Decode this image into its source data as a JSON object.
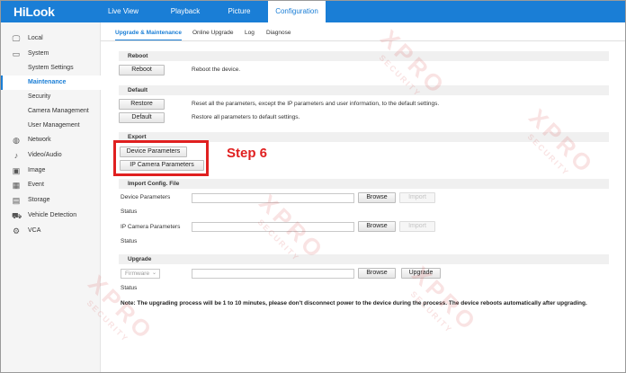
{
  "app": {
    "logo": "HiLook"
  },
  "nav": {
    "tabs": [
      {
        "label": "Live View"
      },
      {
        "label": "Playback"
      },
      {
        "label": "Picture"
      },
      {
        "label": "Configuration"
      }
    ]
  },
  "sidebar": {
    "local": "Local",
    "system": "System",
    "system_settings": "System Settings",
    "maintenance": "Maintenance",
    "security": "Security",
    "camera_management": "Camera Management",
    "user_management": "User Management",
    "network": "Network",
    "video_audio": "Video/Audio",
    "image": "Image",
    "event": "Event",
    "storage": "Storage",
    "vehicle_detection": "Vehicle Detection",
    "vca": "VCA"
  },
  "subtabs": {
    "upgrade_maintenance": "Upgrade & Maintenance",
    "online_upgrade": "Online Upgrade",
    "log": "Log",
    "diagnose": "Diagnose"
  },
  "reboot": {
    "title": "Reboot",
    "button": "Reboot",
    "desc": "Reboot the device."
  },
  "default": {
    "title": "Default",
    "restore_button": "Restore",
    "restore_desc": "Reset all the parameters, except the IP parameters and user information, to the default settings.",
    "default_button": "Default",
    "default_desc": "Restore all parameters to default settings."
  },
  "export": {
    "title": "Export",
    "device_params_button": "Device Parameters",
    "ip_camera_params_button": "IP Camera Parameters"
  },
  "annotation": {
    "step": "Step 6",
    "color": "#e02020"
  },
  "import": {
    "title": "Import Config. File",
    "device_params_label": "Device Parameters",
    "status_label_1": "Status",
    "ip_camera_params_label": "IP Camera Parameters",
    "status_label_2": "Status",
    "browse": "Browse",
    "import": "Import"
  },
  "upgrade": {
    "title": "Upgrade",
    "select_value": "Firmware",
    "browse": "Browse",
    "upgrade_button": "Upgrade",
    "status_label": "Status",
    "note": "Note: The upgrading process will be 1 to 10 minutes, please don't disconnect power to the device during the process. The device reboots automatically after upgrading."
  },
  "watermark": {
    "big": "XPRO",
    "small": "SECURITY"
  },
  "colors": {
    "brand": "#1a7ed6",
    "highlight": "#e02020"
  }
}
